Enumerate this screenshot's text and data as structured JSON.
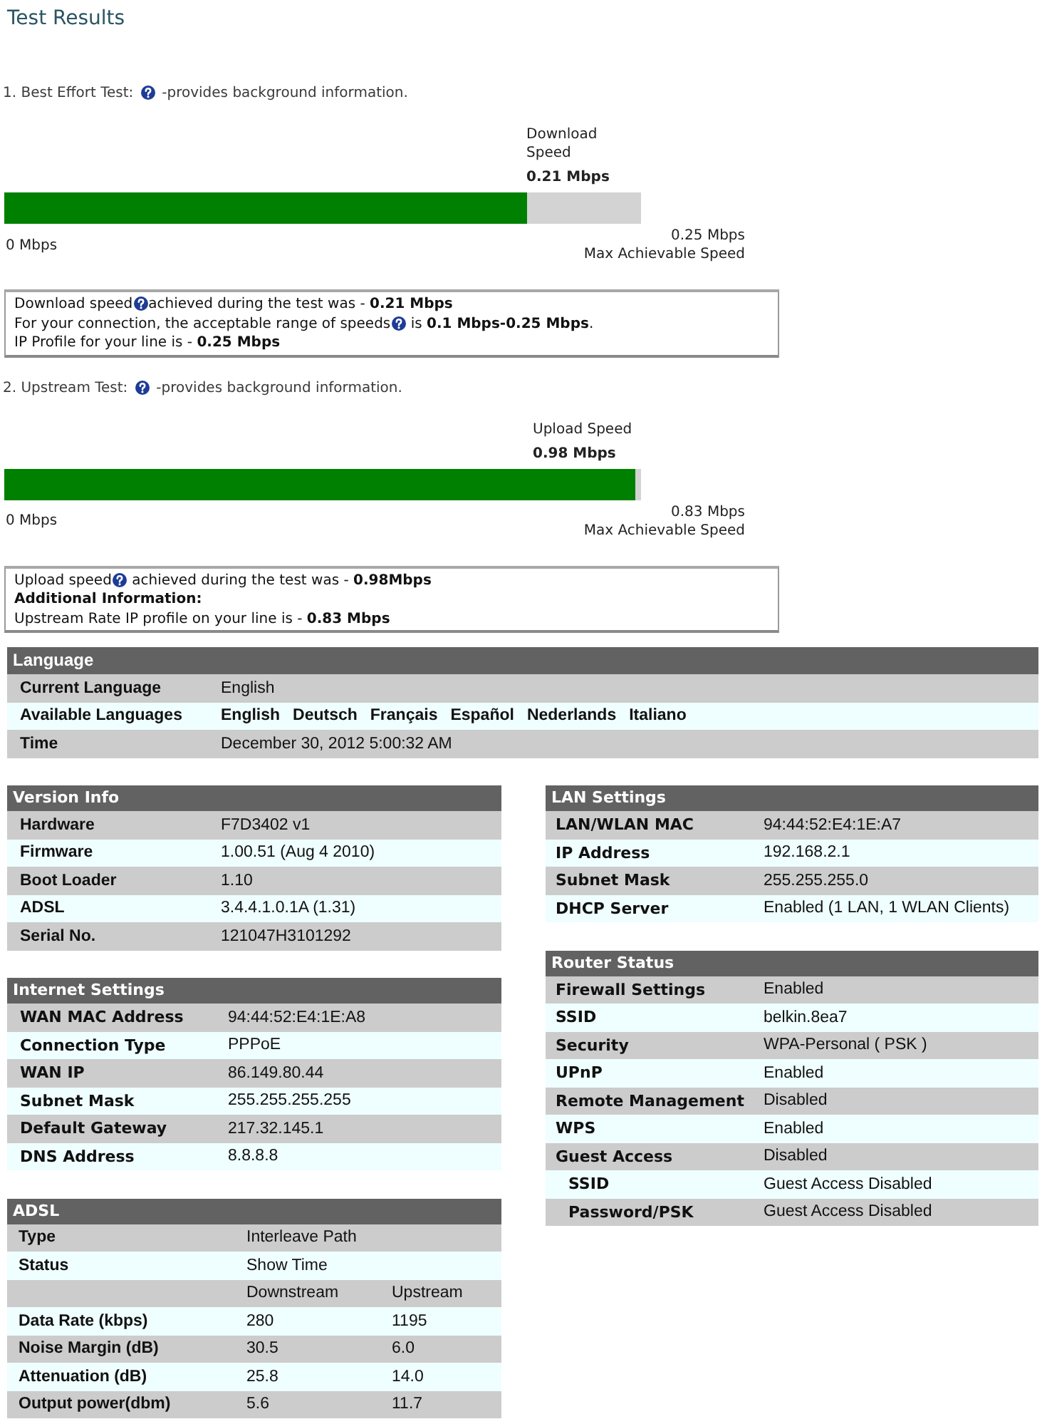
{
  "page": {
    "title": "Test Results"
  },
  "tests": [
    {
      "heading": [
        {
          "kind": "text",
          "text": "1. Best Effort Test:"
        },
        {
          "kind": "help"
        },
        {
          "kind": "text",
          "text": "-provides background information."
        }
      ],
      "speed_label": "Download\nSpeed",
      "speed": "0.21 Mbps",
      "level": 0.82,
      "min_label": "0 Mbps",
      "max_value": "0.25 Mbps",
      "max_label": "Max Achievable Speed",
      "info": [
        [
          {
            "kind": "text",
            "text": "Download speed"
          },
          {
            "kind": "help"
          },
          {
            "kind": "text",
            "text": "achieved during the test was - **0.21 Mbps**"
          }
        ],
        [
          {
            "kind": "text",
            "text": "For your connection, the acceptable range of speeds"
          },
          {
            "kind": "help"
          },
          {
            "kind": "text",
            "text": " is **0.1 Mbps-0.25 Mbps**."
          }
        ],
        [
          {
            "kind": "text",
            "text": "IP Profile for your line is - **0.25 Mbps**"
          }
        ]
      ]
    },
    {
      "heading": [
        {
          "kind": "text",
          "text": "2. Upstream Test:"
        },
        {
          "kind": "help"
        },
        {
          "kind": "text",
          "text": "-provides background information."
        }
      ],
      "speed_label": "Upload Speed",
      "speed": "0.98 Mbps",
      "level": 0.99,
      "min_label": "0 Mbps",
      "max_value": "0.83 Mbps",
      "max_label": "Max Achievable Speed",
      "info": [
        [
          {
            "kind": "text",
            "text": "Upload speed"
          },
          {
            "kind": "help"
          },
          {
            "kind": "text",
            "text": " achieved during the test was - **0.98Mbps**"
          }
        ],
        [
          {
            "kind": "bold",
            "text": "Additional Information:"
          }
        ],
        [
          {
            "kind": "text",
            "text": "Upstream Rate IP profile on your line is - **0.83 Mbps**"
          }
        ]
      ]
    }
  ],
  "language": {
    "title": "Language",
    "rows": [
      {
        "label": "Current Language",
        "value": "English"
      },
      {
        "label": "Available Languages",
        "links": [
          "English",
          "Deutsch",
          "Français",
          "Español",
          "Nederlands",
          "Italiano"
        ]
      },
      {
        "label": "Time",
        "value": "December 30, 2012 5:00:32 AM"
      }
    ]
  },
  "version_info": {
    "title": "Version Info",
    "rows": [
      {
        "label": "Hardware",
        "value": "F7D3402 v1"
      },
      {
        "label": "Firmware",
        "value": "1.00.51 (Aug 4 2010)"
      },
      {
        "label": "Boot Loader",
        "value": "1.10"
      },
      {
        "label": "ADSL",
        "value": "3.4.4.1.0.1A (1.31)"
      },
      {
        "label": "Serial No.",
        "value": "121047H3101292"
      }
    ]
  },
  "internet_settings": {
    "title": "Internet Settings",
    "rows": [
      {
        "label": "WAN MAC Address",
        "value": "94:44:52:E4:1E:A8"
      },
      {
        "label": "Connection Type",
        "value": "PPPoE"
      },
      {
        "label": "WAN IP",
        "value": "86.149.80.44"
      },
      {
        "label": "Subnet Mask",
        "value": "255.255.255.255"
      },
      {
        "label": "Default Gateway",
        "value": "217.32.145.1"
      },
      {
        "label": "DNS Address",
        "value": "8.8.8.8"
      }
    ]
  },
  "adsl": {
    "title": "ADSL",
    "rows": [
      {
        "label": "Type",
        "value": "Interleave Path"
      },
      {
        "label": "Status",
        "value": "Show Time"
      },
      {
        "values": [
          "Downstream",
          "Upstream"
        ]
      },
      {
        "label": "Data Rate (kbps)",
        "values": [
          "280",
          "1195"
        ]
      },
      {
        "label": "Noise Margin (dB)",
        "values": [
          "30.5",
          "6.0"
        ]
      },
      {
        "label": "Attenuation (dB)",
        "values": [
          "25.8",
          "14.0"
        ]
      },
      {
        "label": "Output power(dbm)",
        "values": [
          "5.6",
          "11.7"
        ]
      }
    ]
  },
  "lan_settings": {
    "title": "LAN Settings",
    "rows": [
      {
        "label": "LAN/WLAN MAC",
        "value": "94:44:52:E4:1E:A7"
      },
      {
        "label": "IP Address",
        "value": "192.168.2.1"
      },
      {
        "label": "Subnet Mask",
        "value": "255.255.255.0"
      },
      {
        "label": "DHCP Server",
        "value": "Enabled (1 LAN, 1 WLAN Clients)"
      }
    ]
  },
  "router_status": {
    "title": "Router Status",
    "rows": [
      {
        "label": "Firewall Settings",
        "value": "Enabled"
      },
      {
        "label": "SSID",
        "value": "belkin.8ea7"
      },
      {
        "label": "Security",
        "value": "WPA-Personal ( PSK )"
      },
      {
        "label": "UPnP",
        "value": "Enabled"
      },
      {
        "label": "Remote Management",
        "value": "Disabled"
      },
      {
        "label": "WPS",
        "value": "Enabled"
      },
      {
        "label": "Guest Access",
        "value": "Disabled",
        "children": [
          {
            "label": "SSID",
            "value": "Guest Access Disabled"
          },
          {
            "label": "Password/PSK",
            "value": "Guest Access Disabled"
          }
        ]
      }
    ]
  }
}
